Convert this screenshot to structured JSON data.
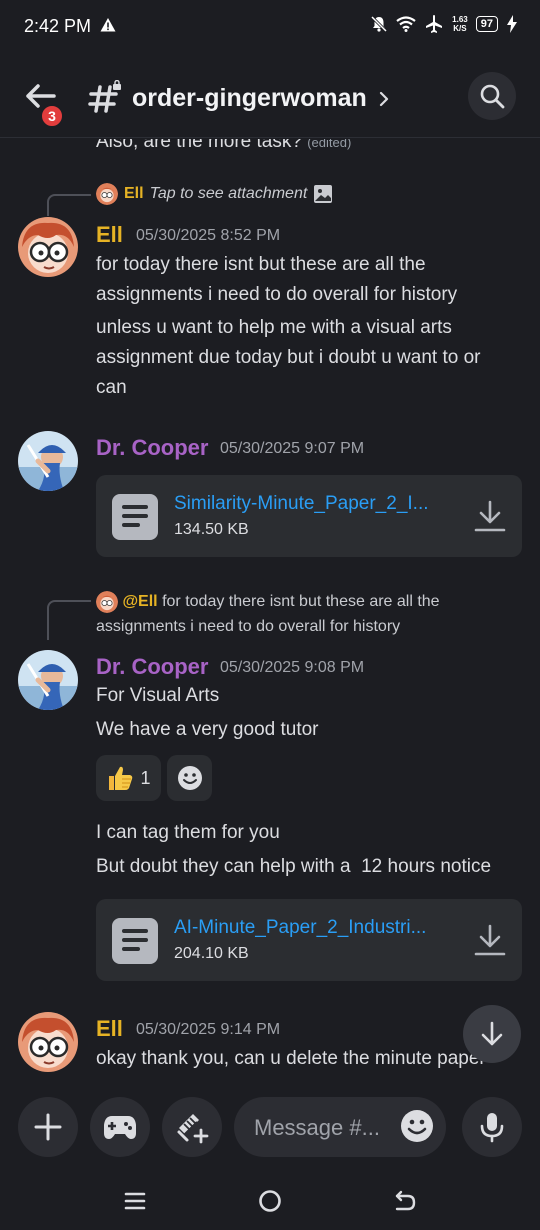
{
  "status": {
    "time": "2:42 PM",
    "net_speed_value": "1.63",
    "net_speed_unit": "K/S",
    "battery": "97"
  },
  "header": {
    "badge_count": "3",
    "channel_name": "order-gingerwoman"
  },
  "messages": {
    "top_partial": {
      "text": "Also, are the more task?",
      "edited": "(edited)"
    },
    "msg1": {
      "reply_name": "Ell",
      "reply_text": "Tap to see attachment",
      "author": "Ell",
      "time": "05/30/2025 8:52 PM",
      "p1_l1": "for today there isnt but these are all the",
      "p1_l2": "assignments i need to do overall for history",
      "p2_l1": "unless u want to help me with a visual arts",
      "p2_l2": "assignment due today but i doubt u want to or",
      "p2_l3": "can"
    },
    "msg2": {
      "author": "Dr. Cooper",
      "time": "05/30/2025 9:07 PM",
      "file_name": "Similarity-Minute_Paper_2_I...",
      "file_size": "134.50 KB"
    },
    "msg3": {
      "reply_name": "@Ell",
      "reply_l1": "for today there isnt but these are all the",
      "reply_l2": "assignments i need to do overall for history",
      "author": "Dr. Cooper",
      "time": "05/30/2025 9:08 PM",
      "line1": "For Visual Arts",
      "line2": "We have a very good tutor",
      "reaction_count": "1",
      "line3": "I can tag them for you",
      "line4": "But doubt they can help with a  12 hours notice",
      "file_name": "AI-Minute_Paper_2_Industri...",
      "file_size": "204.10 KB"
    },
    "msg4": {
      "author": "Ell",
      "time": "05/30/2025 9:14 PM",
      "line1": "okay thank you, can u delete the minute paper"
    }
  },
  "composer": {
    "placeholder": "Message #..."
  },
  "colors": {
    "background": "#1c1d22",
    "ell_name": "#e6b325",
    "cooper_name": "#a863c6",
    "link": "#2a9ef5",
    "badge": "#e23d3d"
  },
  "icons": [
    "back-arrow-icon",
    "hash-icon",
    "chevron-right-icon",
    "search-icon",
    "image-icon",
    "file-icon",
    "download-icon",
    "thumbs-up-icon",
    "add-reaction-icon",
    "arrow-down-icon",
    "plus-icon",
    "gamepad-icon",
    "gift-icon",
    "emoji-icon",
    "microphone-icon",
    "recent-apps-icon",
    "home-icon",
    "back-icon"
  ]
}
